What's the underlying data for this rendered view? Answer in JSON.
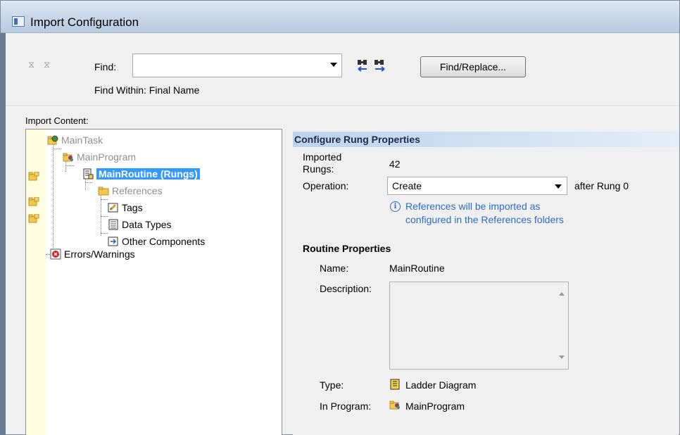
{
  "window": {
    "title": "Import Configuration"
  },
  "find": {
    "label": "Find:",
    "value": "",
    "find_within_label": "Find Within: Final Name",
    "find_replace_button": "Find/Replace..."
  },
  "import_content": {
    "label": "Import Content:",
    "tree": [
      {
        "label": "MainTask",
        "icon": "task-folder-icon",
        "style": "gray"
      },
      {
        "label": "MainProgram",
        "icon": "program-icon",
        "style": "gray"
      },
      {
        "label": "MainRoutine (Rungs)",
        "icon": "routine-icon",
        "style": "selected"
      },
      {
        "label": "References",
        "icon": "folder-icon",
        "style": "gray"
      },
      {
        "label": "Tags",
        "icon": "tags-icon",
        "style": "normal"
      },
      {
        "label": "Data Types",
        "icon": "data-types-icon",
        "style": "normal"
      },
      {
        "label": "Other Components",
        "icon": "other-components-icon",
        "style": "normal"
      },
      {
        "label": "Errors/Warnings",
        "icon": "error-icon",
        "style": "normal"
      }
    ]
  },
  "rung_properties": {
    "header": "Configure Rung Properties",
    "imported_rungs_label": "Imported Rungs:",
    "imported_rungs_line1": "Imported",
    "imported_rungs_line2": "Rungs:",
    "imported_rungs_value": "42",
    "operation_label": "Operation:",
    "operation_value": "Create",
    "operation_suffix": "after Rung 0",
    "info_line1": "References will be imported as",
    "info_line2": "configured in the References folders"
  },
  "routine_properties": {
    "title": "Routine Properties",
    "name_label": "Name:",
    "name_value": "MainRoutine",
    "description_label": "Description:",
    "description_value": "",
    "type_label": "Type:",
    "type_value": "Ladder Diagram",
    "in_program_label": "In Program:",
    "in_program_value": "MainProgram"
  },
  "colors": {
    "selection": "#3399ff",
    "info_text": "#2e6bc6",
    "header_gradient_start": "#bcd3ee"
  }
}
